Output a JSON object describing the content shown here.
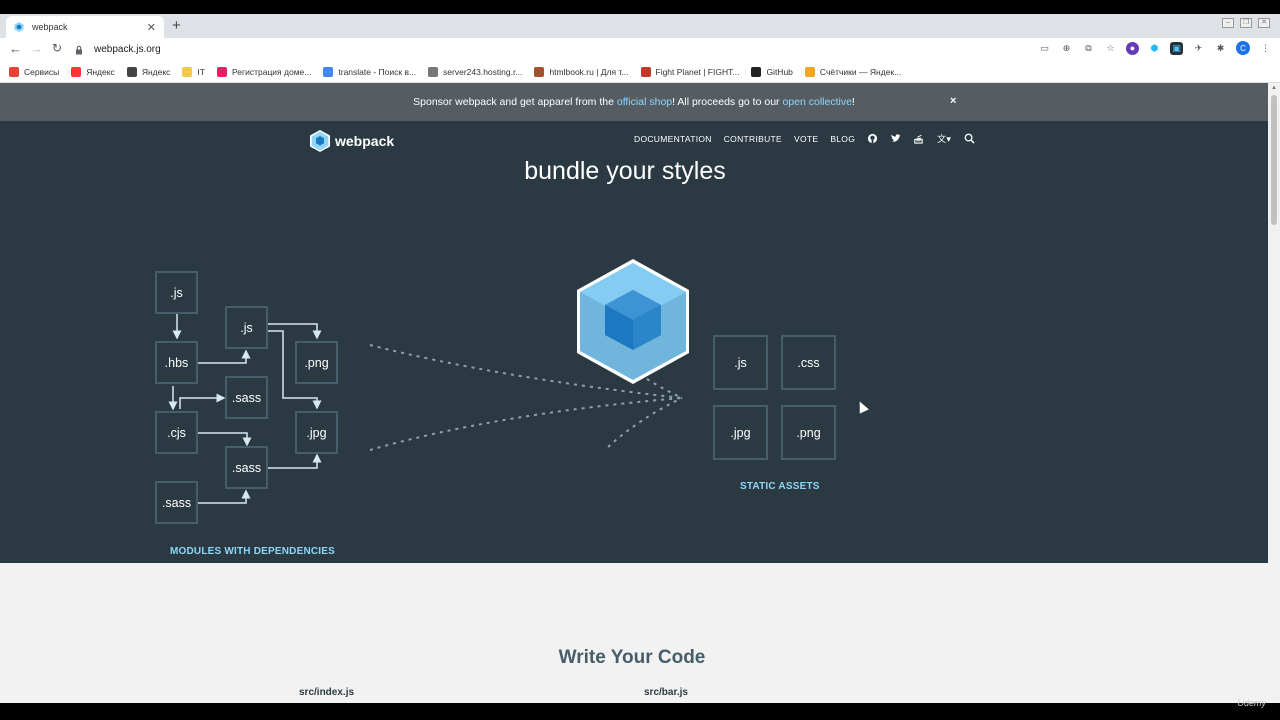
{
  "browser": {
    "tab_title": "webpack",
    "url": "webpack.js.org",
    "bookmarks": [
      {
        "label": "Сервисы",
        "color": "#e94235"
      },
      {
        "label": "Яндекс",
        "color": "#f33"
      },
      {
        "label": "Яндекс",
        "color": "#444"
      },
      {
        "label": "IT",
        "color": "#f2c94c"
      },
      {
        "label": "Регистрация доме...",
        "color": "#e91e63"
      },
      {
        "label": "translate - Поиск в...",
        "color": "#4285f4"
      },
      {
        "label": "server243.hosting.r...",
        "color": "#777"
      },
      {
        "label": "htmlbook.ru | Для т...",
        "color": "#a0522d"
      },
      {
        "label": "Fight Planet | FIGHT...",
        "color": "#c0392b"
      },
      {
        "label": "GitHub",
        "color": "#222"
      },
      {
        "label": "Счётчики — Яндек...",
        "color": "#f5a623"
      }
    ],
    "profile_initial": "C"
  },
  "sponsor": {
    "text_before": "Sponsor webpack and get apparel from the ",
    "link1": "official shop",
    "text_middle": "! All proceeds go to our ",
    "link2": "open collective",
    "text_after": "!",
    "close": "×"
  },
  "header": {
    "logo_text": "webpack",
    "nav": [
      "DOCUMENTATION",
      "CONTRIBUTE",
      "VOTE",
      "BLOG"
    ]
  },
  "hero": {
    "title": "bundle your styles",
    "modules": [
      ".js",
      ".js",
      ".hbs",
      ".png",
      ".sass",
      ".cjs",
      ".jpg",
      ".sass",
      ".sass"
    ],
    "assets": [
      ".js",
      ".css",
      ".jpg",
      ".png"
    ],
    "modules_caption": "MODULES WITH DEPENDENCIES",
    "assets_caption": "STATIC ASSETS"
  },
  "lower": {
    "title": "Write Your Code",
    "file1": "src/index.js",
    "file2": "src/bar.js"
  },
  "colors": {
    "hero_bg": "#2b3a42",
    "accent": "#8dd6f9",
    "box_border": "#465e69",
    "cube_light": "#8ed6fb",
    "cube_dark": "#1c78c0"
  }
}
